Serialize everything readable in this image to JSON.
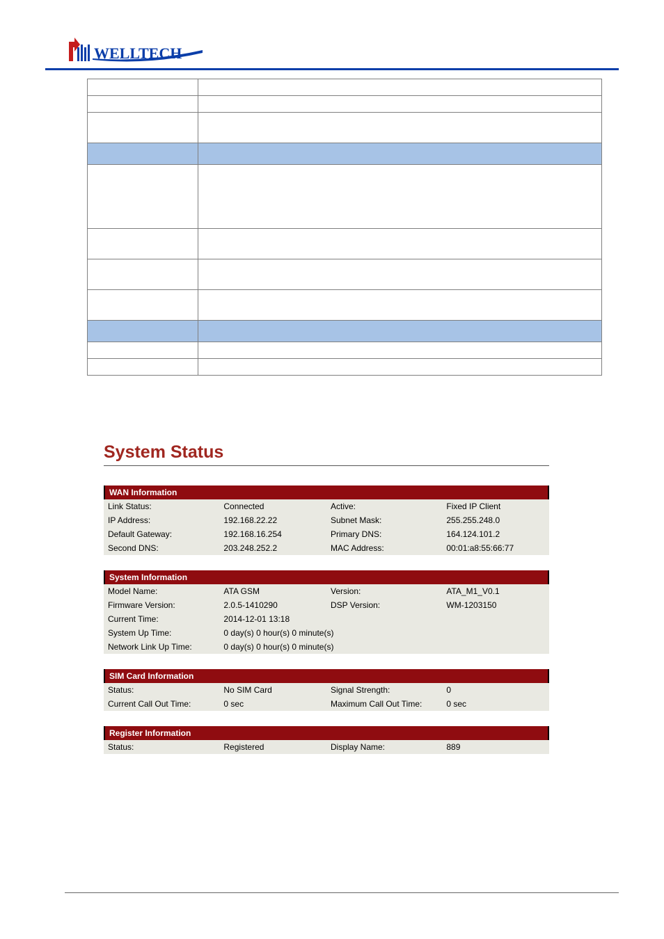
{
  "brand": {
    "name": "WELLTECH"
  },
  "page_title": "System Status",
  "sections": {
    "wan": {
      "header": "WAN Information",
      "rows": [
        [
          "Link Status:",
          "Connected",
          "Active:",
          "Fixed IP Client"
        ],
        [
          "IP Address:",
          "192.168.22.22",
          "Subnet Mask:",
          "255.255.248.0"
        ],
        [
          "Default Gateway:",
          "192.168.16.254",
          "Primary DNS:",
          "164.124.101.2"
        ],
        [
          "Second DNS:",
          "203.248.252.2",
          "MAC Address:",
          "00:01:a8:55:66:77"
        ]
      ]
    },
    "system": {
      "header": "System Information",
      "rows": [
        [
          "Model Name:",
          "ATA GSM",
          "Version:",
          "ATA_M1_V0.1"
        ],
        [
          "Firmware Version:",
          "2.0.5-1410290",
          "DSP Version:",
          "WM-1203150"
        ],
        [
          "Current Time:",
          "2014-12-01 13:18",
          "",
          ""
        ],
        [
          "System Up Time:",
          "0 day(s) 0 hour(s) 0 minute(s)",
          "",
          ""
        ],
        [
          "Network Link Up Time:",
          "0 day(s) 0 hour(s) 0 minute(s)",
          "",
          ""
        ]
      ]
    },
    "sim": {
      "header": "SIM Card Information",
      "rows": [
        [
          "Status:",
          "No SIM Card",
          "Signal Strength:",
          "0"
        ],
        [
          "Current Call Out Time:",
          "0 sec",
          "Maximum Call Out Time:",
          "0 sec"
        ]
      ]
    },
    "register": {
      "header": "Register Information",
      "rows": [
        [
          "Status:",
          "Registered",
          "Display Name:",
          "889"
        ]
      ]
    }
  }
}
